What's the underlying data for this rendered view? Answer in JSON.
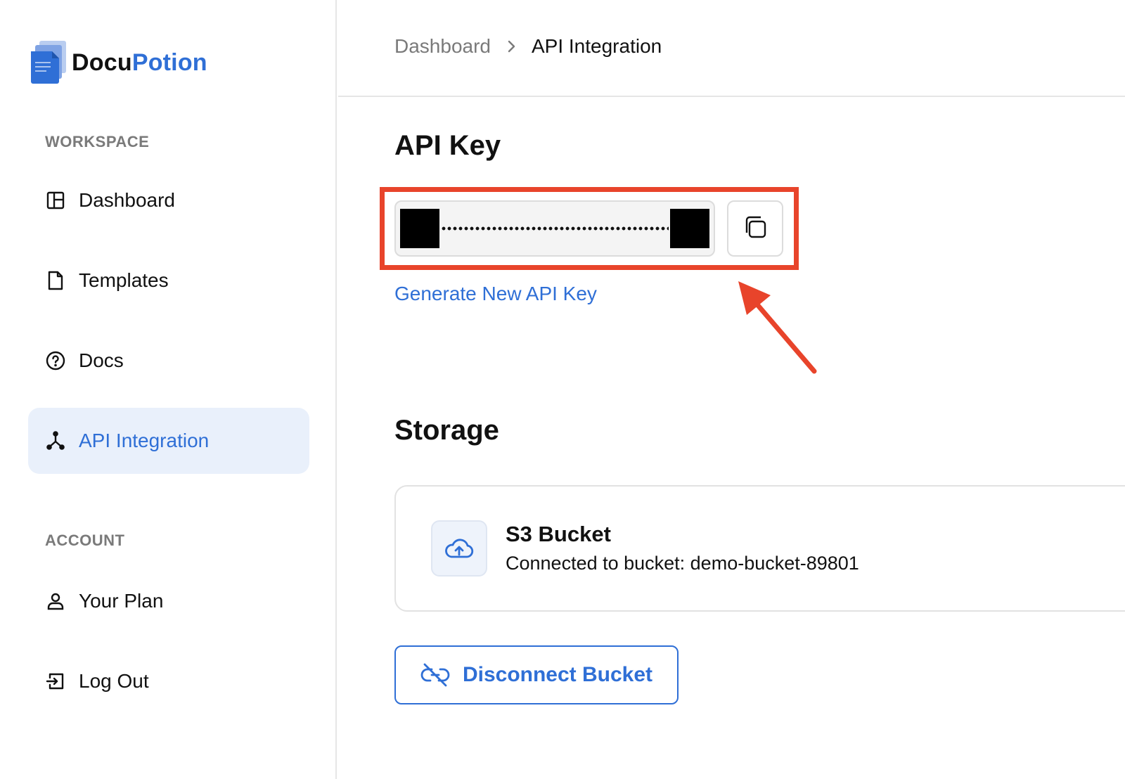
{
  "brand": {
    "name_part1": "Docu",
    "name_part2": "Potion",
    "colors": {
      "primary": "#2f6fd6",
      "annotation": "#e8442b"
    }
  },
  "sidebar": {
    "sections": [
      {
        "label": "WORKSPACE",
        "items": [
          {
            "label": "Dashboard",
            "icon": "layout-icon"
          },
          {
            "label": "Templates",
            "icon": "file-icon"
          },
          {
            "label": "Docs",
            "icon": "help-circle-icon"
          },
          {
            "label": "API Integration",
            "icon": "api-icon",
            "active": true
          }
        ]
      },
      {
        "label": "ACCOUNT",
        "items": [
          {
            "label": "Your Plan",
            "icon": "user-icon"
          },
          {
            "label": "Log Out",
            "icon": "logout-icon"
          }
        ]
      }
    ]
  },
  "breadcrumb": [
    "Dashboard",
    "API Integration"
  ],
  "api_key": {
    "heading": "API Key",
    "generate_label": "Generate New API Key",
    "copy_icon": "copy-icon"
  },
  "storage": {
    "heading": "Storage",
    "bucket_title": "S3 Bucket",
    "bucket_desc": "Connected to bucket: demo-bucket-89801",
    "bucket_icon": "cloud-upload-icon",
    "disconnect_label": "Disconnect Bucket",
    "disconnect_icon": "unlink-icon"
  }
}
